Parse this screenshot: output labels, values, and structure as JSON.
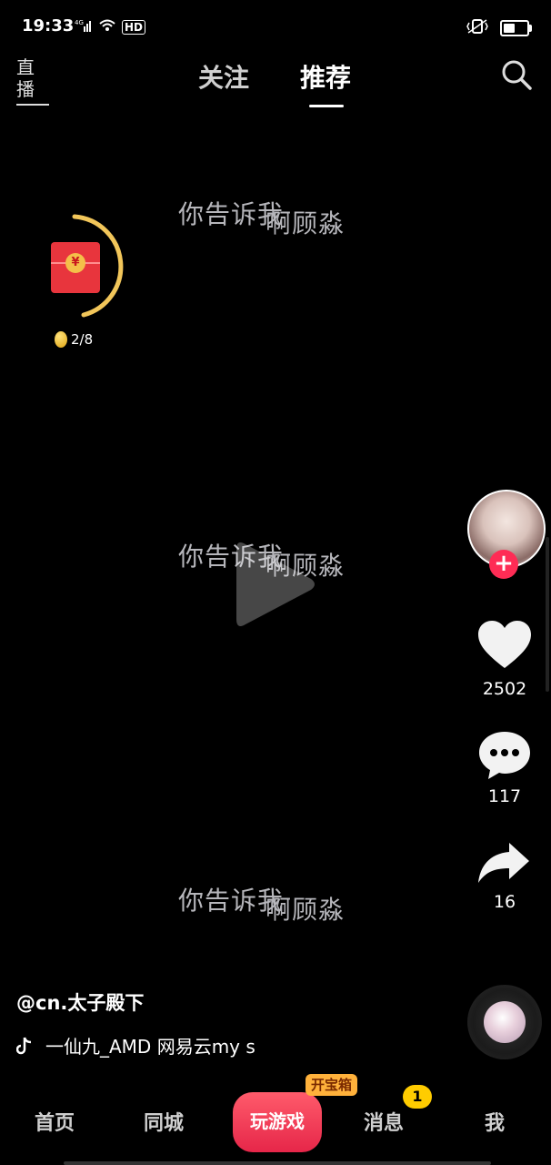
{
  "status_bar": {
    "time": "19:33",
    "network": "4G",
    "hd": "HD"
  },
  "top_nav": {
    "live_label": "直播",
    "tabs": [
      {
        "label": "关注"
      },
      {
        "label": "推荐"
      }
    ]
  },
  "red_packet": {
    "coin_symbol": "¥",
    "progress": "2/8"
  },
  "lyrics": {
    "line_part1": "你告诉我",
    "line_part2": "啊顾淼"
  },
  "creator": {
    "like_count": "2502",
    "comment_count": "117",
    "share_count": "16"
  },
  "video_info": {
    "author": "@cn.太子殿下",
    "music": "一仙九_AMD    网易云my s"
  },
  "bottom_nav": {
    "home": "首页",
    "city": "同城",
    "game": "玩游戏",
    "chest_badge": "开宝箱",
    "messages": "消息",
    "messages_badge": "1",
    "me": "我"
  },
  "colors": {
    "accent": "#fe2c55",
    "badge": "#ffcc00",
    "lyric": "#b6b6bb"
  }
}
